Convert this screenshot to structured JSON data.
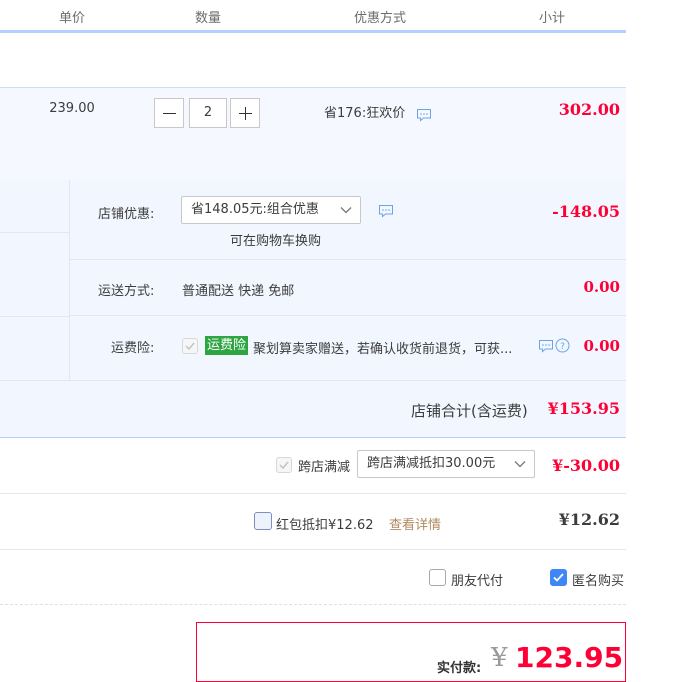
{
  "header": {
    "col_price": "单价",
    "col_qty": "数量",
    "col_promo": "优惠方式",
    "col_subtotal": "小计"
  },
  "item": {
    "price": "239.00",
    "quantity": "2",
    "promo_text": "省176:狂欢价",
    "subtotal": "302.00"
  },
  "shop": {
    "discount_label": "店铺优惠:",
    "discount_select": "省148.05元:组合优惠",
    "discount_hint": "可在购物车换购",
    "discount_amount": "-148.05",
    "shipping_label": "运送方式:",
    "shipping_value": "普通配送 快递 免邮",
    "shipping_amount": "0.00",
    "insurance_label": "运费险:",
    "insurance_badge": "运费险",
    "insurance_text": "聚划算卖家赠送，若确认收货前退货，可获...",
    "insurance_amount": "0.00",
    "total_label": "店铺合计(含运费)",
    "total_amount": "¥153.95"
  },
  "cross_store": {
    "label": "跨店满减",
    "select": "跨店满减抵扣30.00元",
    "amount": "¥-30.00"
  },
  "red_packet": {
    "label": "红包抵扣¥12.62",
    "link": "查看详情",
    "amount": "¥12.62"
  },
  "options": {
    "friend_pay": "朋友代付",
    "anonymous": "匿名购买"
  },
  "payment": {
    "label": "实付款:",
    "currency": "¥",
    "amount": "123.95"
  },
  "colors": {
    "accent_red": "#ff0036",
    "header_border": "#b2d1ff",
    "shop_bg": "#f2f7ff",
    "badge_green": "#2da641",
    "checkbox_blue": "#3f86f7"
  }
}
